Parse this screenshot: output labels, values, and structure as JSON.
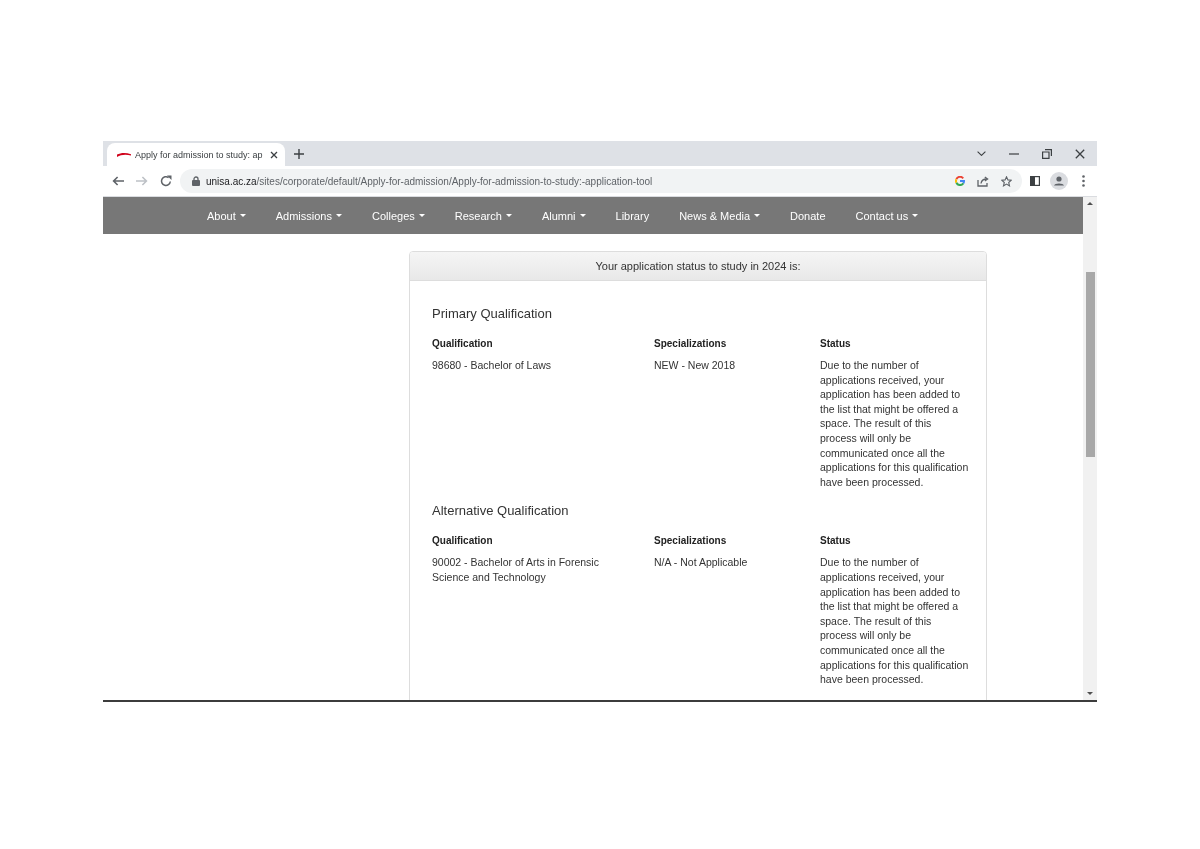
{
  "browser": {
    "tab": {
      "title": "Apply for admission to study: ap"
    },
    "address_bar": {
      "host": "unisa.ac.za",
      "path": "/sites/corporate/default/Apply-for-admission/Apply-for-admission-to-study:-application-tool"
    }
  },
  "nav": {
    "items": [
      {
        "label": "About",
        "has_menu": true
      },
      {
        "label": "Admissions",
        "has_menu": true
      },
      {
        "label": "Colleges",
        "has_menu": true
      },
      {
        "label": "Research",
        "has_menu": true
      },
      {
        "label": "Alumni",
        "has_menu": true
      },
      {
        "label": "Library",
        "has_menu": false
      },
      {
        "label": "News & Media",
        "has_menu": true
      },
      {
        "label": "Donate",
        "has_menu": false
      },
      {
        "label": "Contact us",
        "has_menu": true
      }
    ]
  },
  "status_panel": {
    "heading": "Your application status to study in 2024 is:",
    "sections": [
      {
        "title": "Primary Qualification",
        "columns": [
          "Qualification",
          "Specializations",
          "Status"
        ],
        "rows": [
          [
            "98680 - Bachelor of Laws",
            "NEW - New 2018",
            "Due to the number of applications received, your application has been added to the list that might be offered a space. The result of this process will only be communicated once all the applications for this qualification have been processed."
          ]
        ]
      },
      {
        "title": "Alternative Qualification",
        "columns": [
          "Qualification",
          "Specializations",
          "Status"
        ],
        "rows": [
          [
            "90002 - Bachelor of Arts in Forensic Science and Technology",
            "N/A - Not Applicable",
            "Due to the number of applications received, your application has been added to the list that might be offered a space. The result of this process will only be communicated once all the applications for this qualification have been processed."
          ]
        ]
      }
    ]
  }
}
